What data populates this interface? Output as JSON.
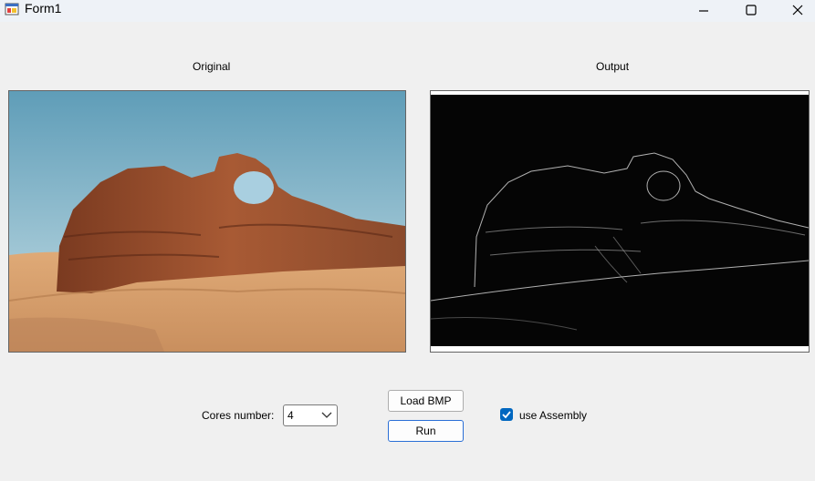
{
  "window": {
    "title": "Form1",
    "minimize_glyph": "—",
    "maximize_glyph": "☐",
    "close_glyph": "✕"
  },
  "labels": {
    "original": "Original",
    "output": "Output",
    "cores": "Cores number:"
  },
  "cores_select": {
    "value": "4"
  },
  "buttons": {
    "load": "Load BMP",
    "run": "Run"
  },
  "assembly_checkbox": {
    "label": "use Assembly",
    "checked": true
  },
  "icons": {
    "app": "form-app-icon",
    "dropdown": "chevron-down-icon",
    "check": "checkmark-icon"
  }
}
